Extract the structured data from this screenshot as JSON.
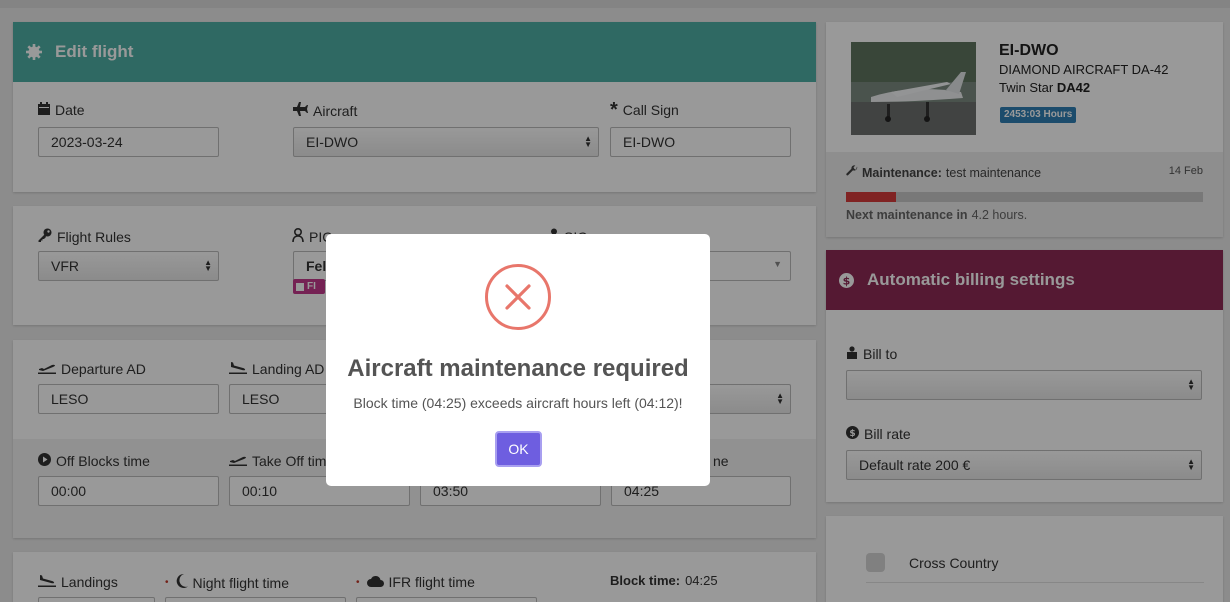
{
  "edit_flight": {
    "title": "Edit flight",
    "date_label": "Date",
    "date_value": "2023-03-24",
    "aircraft_label": "Aircraft",
    "aircraft_value": "EI-DWO",
    "callsign_label": "Call Sign",
    "callsign_value": "EI-DWO"
  },
  "crew": {
    "flight_rules_label": "Flight Rules",
    "flight_rules_value": "VFR",
    "pic_label": "PIC",
    "pic_value": "Felip",
    "pic_tag": "FI",
    "sic_label": "SIC"
  },
  "route": {
    "departure_label": "Departure AD",
    "departure_value": "LESO",
    "landing_label": "Landing AD",
    "landing_value": "LESO"
  },
  "times": {
    "off_blocks_label": "Off Blocks time",
    "off_blocks_value": "00:00",
    "takeoff_label": "Take Off time",
    "takeoff_value": "00:10",
    "third_value": "03:50",
    "fourth_label_tail": "ne",
    "fourth_value": "04:25"
  },
  "extra": {
    "landings_label": "Landings",
    "night_label": "Night flight time",
    "ifr_label": "IFR flight time",
    "block_time_label": "Block time:",
    "block_time_value": "04:25"
  },
  "aircraft_card": {
    "registration": "EI-DWO",
    "model": "DIAMOND AIRCRAFT DA-42",
    "variant_prefix": "Twin Star",
    "variant_code": "DA42",
    "hours_badge": "2453:03 Hours",
    "maintenance_label": "Maintenance:",
    "maintenance_name": "test maintenance",
    "maintenance_date": "14 Feb",
    "maintenance_progress": 0.14,
    "next_label": "Next maintenance in",
    "next_value": "4.2 hours."
  },
  "billing": {
    "title": "Automatic billing settings",
    "bill_to_label": "Bill to",
    "bill_to_value": "",
    "bill_rate_label": "Bill rate",
    "bill_rate_value": "Default rate 200 €"
  },
  "options": {
    "cross_country_label": "Cross Country"
  },
  "modal": {
    "title": "Aircraft maintenance required",
    "message": "Block time (04:25) exceeds aircraft hours left (04:12)!",
    "ok_label": "OK"
  },
  "colors": {
    "edit_header": "#4fb0a5",
    "billing_header": "#8e2a55",
    "badge": "#2f7fb5",
    "progress": "#d63b3b",
    "ok_button": "#6e5ee0"
  }
}
